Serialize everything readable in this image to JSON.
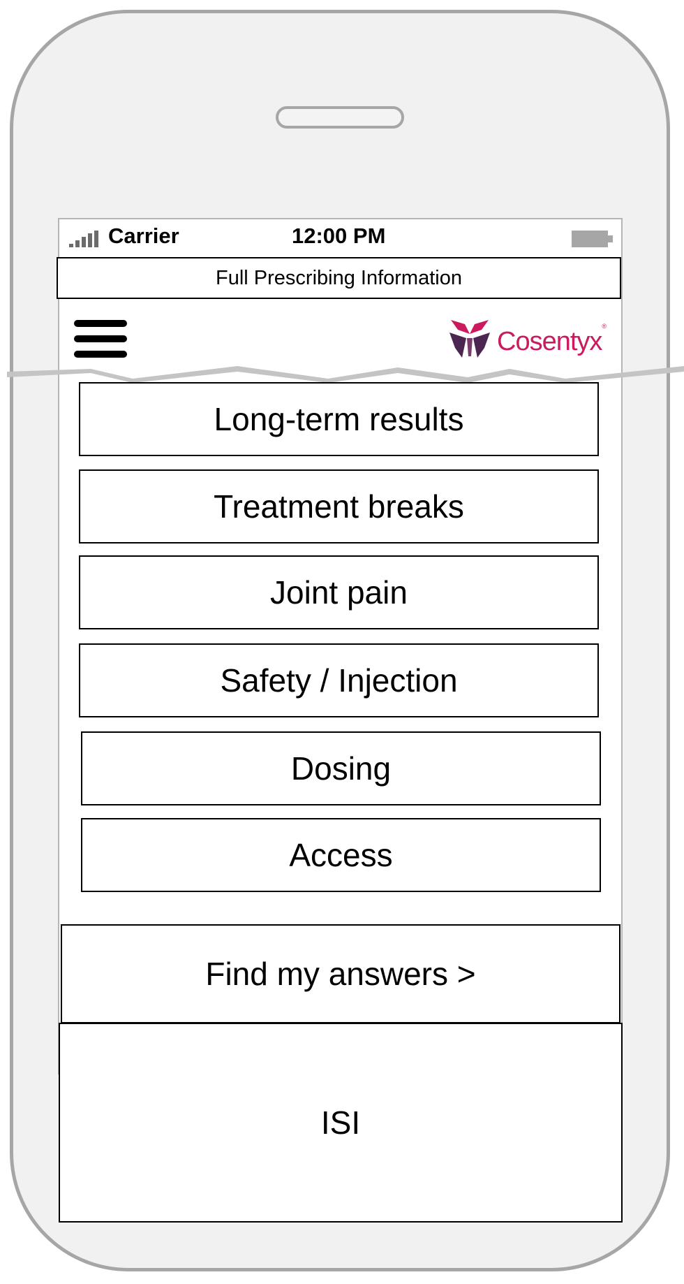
{
  "status_bar": {
    "carrier": "Carrier",
    "time": "12:00 PM"
  },
  "top_banner": {
    "label": "Full Prescribing Information"
  },
  "header": {
    "menu_icon": "hamburger-menu-icon",
    "logo_text": "Cosentyx",
    "logo_mark": "®"
  },
  "menu": {
    "items": [
      {
        "label": "Long-term results"
      },
      {
        "label": "Treatment breaks"
      },
      {
        "label": "Joint pain"
      },
      {
        "label": "Safety / Injection"
      },
      {
        "label": "Dosing"
      },
      {
        "label": "Access"
      }
    ]
  },
  "cta": {
    "label": "Find my answers >"
  },
  "isi": {
    "label": "ISI"
  },
  "colors": {
    "brand": "#cc1a5e",
    "brand_dark": "#4a2650",
    "frame": "#a6a6a6"
  }
}
